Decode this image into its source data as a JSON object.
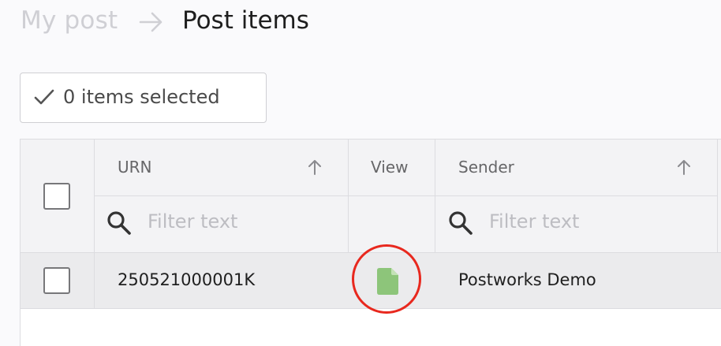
{
  "breadcrumb": {
    "parent": "My post",
    "current": "Post items",
    "separator_icon": "arrow-right-icon"
  },
  "selection": {
    "label": "0 items selected",
    "icon": "check-icon"
  },
  "grid": {
    "columns": [
      {
        "label": "URN",
        "sortable": true,
        "filter_placeholder": "Filter text"
      },
      {
        "label": "View",
        "sortable": false
      },
      {
        "label": "Sender",
        "sortable": true,
        "filter_placeholder": "Filter text"
      }
    ],
    "rows": [
      {
        "urn": "250521000001K",
        "view_icon": "document-icon",
        "sender": "Postworks Demo",
        "selected": false
      }
    ]
  },
  "colors": {
    "document_icon": "#8dc57a",
    "highlight_ring": "#e8281e",
    "header_background": "#f3f3f5",
    "row_background": "#ebebed"
  }
}
